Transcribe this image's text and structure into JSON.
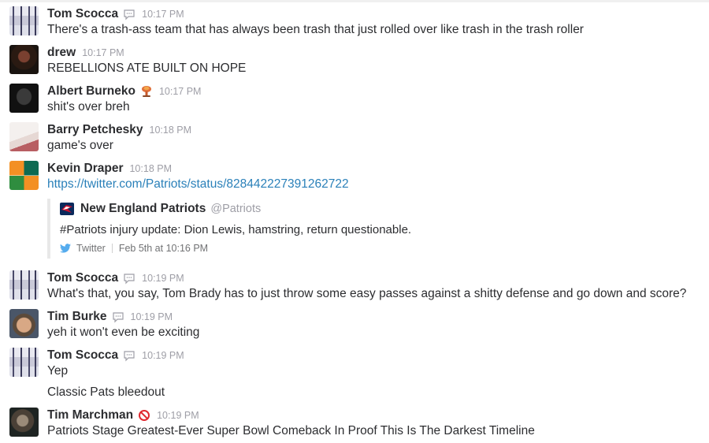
{
  "messages": [
    {
      "author": "Tom Scocca",
      "time": "10:17 PM",
      "status": "speech-bubble",
      "text": "There's a trash-ass team that has always been trash that just rolled over like trash in the trash roller"
    },
    {
      "author": "drew",
      "time": "10:17 PM",
      "status": "",
      "text": "REBELLIONS ATE BUILT ON HOPE"
    },
    {
      "author": "Albert Burneko",
      "time": "10:17 PM",
      "status": "mushroom-cloud",
      "text": "shit's over breh"
    },
    {
      "author": "Barry Petchesky",
      "time": "10:18 PM",
      "status": "",
      "text": "game's over"
    },
    {
      "author": "Kevin Draper",
      "time": "10:18 PM",
      "status": "",
      "text": "https://twitter.com/Patriots/status/828442227391262722"
    },
    {
      "author": "Tom Scocca",
      "time": "10:19 PM",
      "status": "speech-bubble",
      "text": "What's that, you say, Tom Brady has to just throw some easy passes against a shitty defense and go down and score?"
    },
    {
      "author": "Tim Burke",
      "time": "10:19 PM",
      "status": "speech-bubble",
      "text": "yeh it won't even be exciting"
    },
    {
      "author": "Tom Scocca",
      "time": "10:19 PM",
      "status": "speech-bubble",
      "text": "Yep",
      "text2": "Classic Pats bleedout"
    },
    {
      "author": "Tim Marchman",
      "time": "10:19 PM",
      "status": "no-entry",
      "text": "Patriots Stage Greatest-Ever Super Bowl Comeback In Proof This Is The Darkest Timeline"
    }
  ],
  "attachment": {
    "author": "New England Patriots",
    "handle": "@Patriots",
    "text": "#Patriots injury update: Dion Lewis, hamstring, return questionable.",
    "service": "Twitter",
    "date": "Feb 5th at 10:16 PM"
  },
  "colors": {
    "link": "#2a80b9",
    "muted": "#9e9ea6",
    "text": "#2c2d30",
    "twitter": "#55acee"
  }
}
